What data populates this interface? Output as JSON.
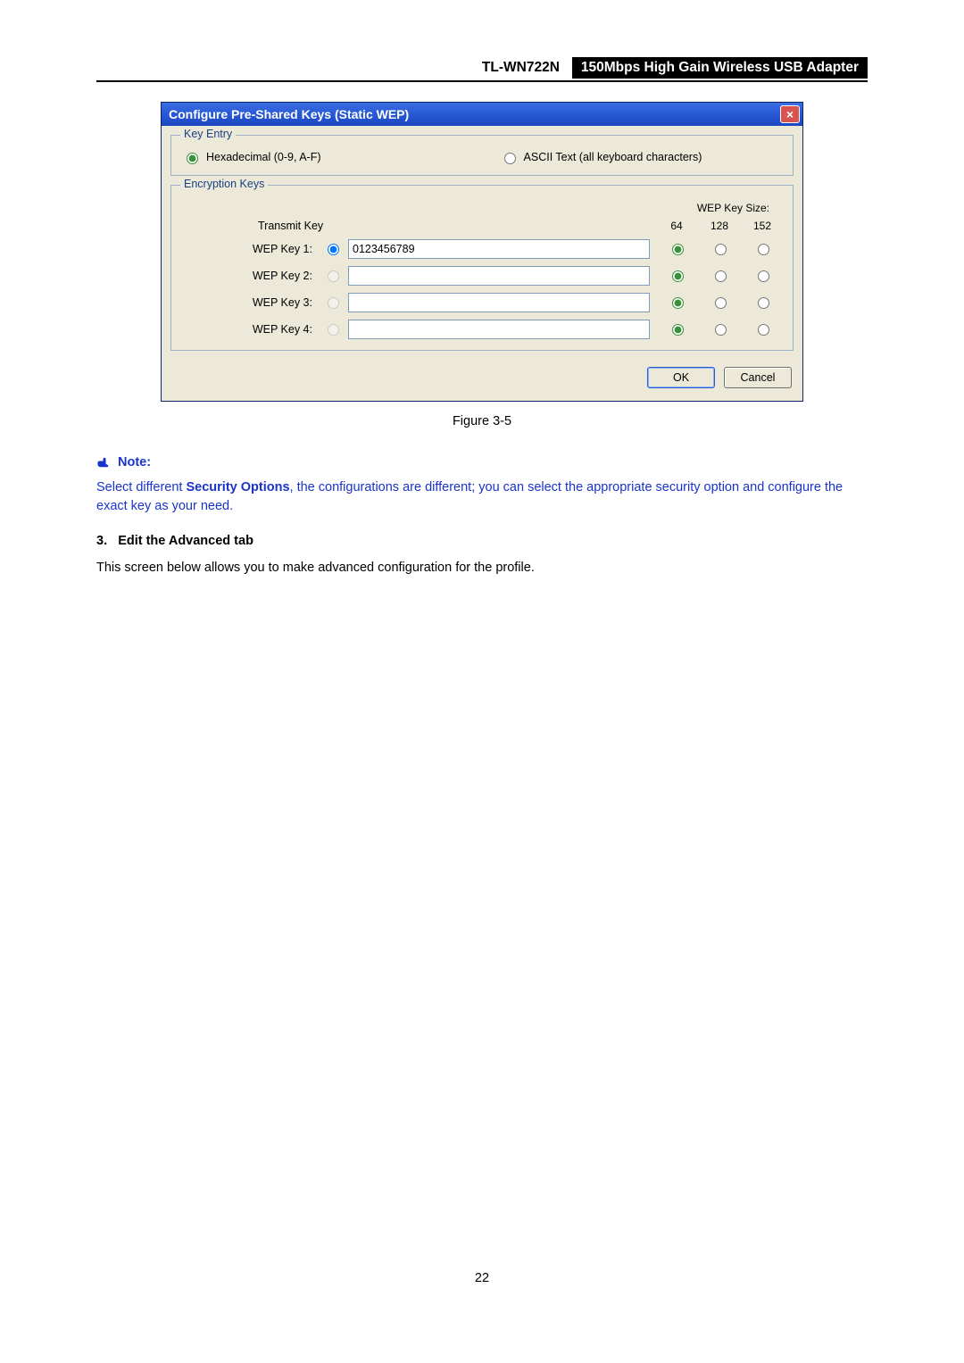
{
  "header": {
    "model": "TL-WN722N",
    "title": "150Mbps High Gain Wireless USB Adapter"
  },
  "dialog": {
    "title": "Configure Pre-Shared Keys (Static WEP)",
    "close_label": "×",
    "key_entry": {
      "legend": "Key Entry",
      "hex_label": "Hexadecimal (0-9, A-F)",
      "ascii_label": "ASCII Text (all keyboard characters)"
    },
    "enc_keys": {
      "legend": "Encryption Keys",
      "transmit_label": "Transmit Key",
      "size_label": "WEP Key Size:",
      "size_cols": {
        "c1": "64",
        "c2": "128",
        "c3": "152"
      },
      "keys": [
        {
          "label": "WEP Key 1:",
          "value": "0123456789"
        },
        {
          "label": "WEP Key 2:",
          "value": ""
        },
        {
          "label": "WEP Key 3:",
          "value": ""
        },
        {
          "label": "WEP Key 4:",
          "value": ""
        }
      ]
    },
    "buttons": {
      "ok": "OK",
      "cancel": "Cancel"
    }
  },
  "figure_caption": "Figure 3-5",
  "note": {
    "heading": "Note:",
    "text_pre": "Select different ",
    "text_bold": "Security Options",
    "text_post": ", the configurations are different; you can select the appropriate security option and configure the exact key as your need."
  },
  "section": {
    "num": "3.",
    "title": "Edit the Advanced tab"
  },
  "body_text": "This screen below allows you to make advanced configuration for the profile.",
  "page_number": "22"
}
